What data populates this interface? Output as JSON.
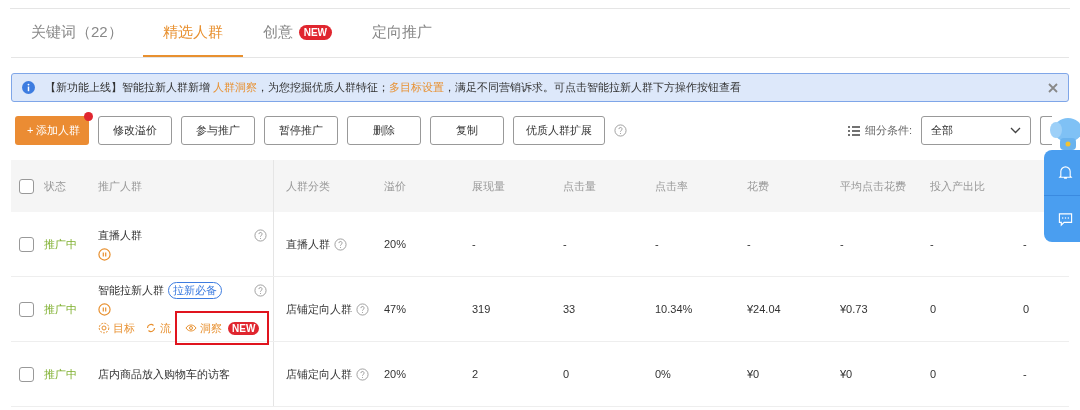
{
  "tabs": [
    {
      "label": "关键词（22）",
      "selected": false
    },
    {
      "label": "精选人群",
      "selected": true
    },
    {
      "label": "创意",
      "selected": false,
      "badge": "NEW"
    },
    {
      "label": "定向推广",
      "selected": false
    }
  ],
  "notice": {
    "parts": [
      {
        "text": "【新功能上线】智能拉新人群新增 ",
        "link": false
      },
      {
        "text": "人群洞察",
        "link": true
      },
      {
        "text": "，为您挖掘优质人群特征；",
        "link": false
      },
      {
        "text": "多目标设置",
        "link": true
      },
      {
        "text": "，满足不同营销诉求。可点击智能拉新人群下方操作按钮查看",
        "link": false
      }
    ]
  },
  "toolbar": {
    "buttons": [
      {
        "label": "+ 添加人群",
        "kind": "primary",
        "dot": true
      },
      {
        "label": "修改溢价",
        "kind": "default",
        "dot": false
      },
      {
        "label": "参与推广",
        "kind": "default",
        "dot": false
      },
      {
        "label": "暂停推广",
        "kind": "default",
        "dot": false
      },
      {
        "label": "删除",
        "kind": "default",
        "dot": false
      },
      {
        "label": "复制",
        "kind": "default",
        "dot": false
      },
      {
        "label": "优质人群扩展",
        "kind": "default",
        "dot": false
      }
    ],
    "filter_label": "细分条件:",
    "filter_value": "全部"
  },
  "table": {
    "all_checked": false,
    "columns": [
      "状态",
      "推广人群",
      "人群分类",
      "溢价",
      "展现量",
      "点击量",
      "点击率",
      "花费",
      "平均点击花费",
      "投入产出比",
      ""
    ],
    "rows": [
      {
        "checked": false,
        "status": "推广中",
        "name": "直播人群",
        "paused": true,
        "category": "直播人群",
        "values": [
          "20%",
          "-",
          "-",
          "-",
          "-",
          "-",
          "-",
          "-"
        ]
      },
      {
        "checked": false,
        "status": "推广中",
        "name": "智能拉新人群",
        "paused": true,
        "tag": "拉新必备",
        "actions": [
          {
            "label": "目标",
            "kind": "gear"
          },
          {
            "label": "流",
            "kind": "cycle"
          },
          {
            "label": "洞察",
            "kind": "eye",
            "badge": "NEW",
            "highlighted": true
          }
        ],
        "category": "店铺定向人群",
        "values": [
          "47%",
          "319",
          "33",
          "10.34%",
          "¥24.04",
          "¥0.73",
          "0",
          "0"
        ]
      },
      {
        "checked": false,
        "status": "推广中",
        "name": "店内商品放入购物车的访客",
        "paused": false,
        "category": "店铺定向人群",
        "values": [
          "20%",
          "2",
          "0",
          "0%",
          "¥0",
          "¥0",
          "0",
          "-"
        ]
      }
    ]
  }
}
